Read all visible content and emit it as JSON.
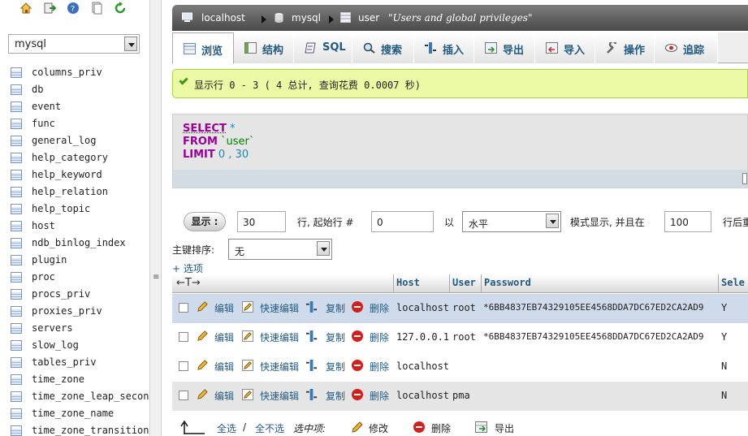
{
  "sidebar": {
    "db_select": "mysql",
    "tables": [
      "columns_priv",
      "db",
      "event",
      "func",
      "general_log",
      "help_category",
      "help_keyword",
      "help_relation",
      "help_topic",
      "host",
      "ndb_binlog_index",
      "plugin",
      "proc",
      "procs_priv",
      "proxies_priv",
      "servers",
      "slow_log",
      "tables_priv",
      "time_zone",
      "time_zone_leap_second",
      "time_zone_name",
      "time_zone_transition"
    ]
  },
  "breadcrumb": {
    "server": "localhost",
    "database": "mysql",
    "table": "user",
    "comment": "\"Users and global privileges\""
  },
  "tabs": [
    {
      "label": "浏览",
      "icon": "browse-icon",
      "active": true
    },
    {
      "label": "结构",
      "icon": "structure-icon"
    },
    {
      "label": "SQL",
      "icon": "sql-icon"
    },
    {
      "label": "搜索",
      "icon": "search-icon"
    },
    {
      "label": "插入",
      "icon": "insert-icon"
    },
    {
      "label": "导出",
      "icon": "export-icon"
    },
    {
      "label": "导入",
      "icon": "import-icon"
    },
    {
      "label": "操作",
      "icon": "wrench-icon"
    },
    {
      "label": "追踪",
      "icon": "eye-icon"
    }
  ],
  "message": "显示行 0 - 3 ( 4 总计, 查询花费 0.0007 秒)",
  "sql": {
    "select_kw": "SELECT",
    "select_rest": " *",
    "from_kw": "FROM",
    "from_rest": " `user`",
    "limit_kw": "LIMIT",
    "limit_rest": " 0 , 30"
  },
  "nav": {
    "show_button": "显示 :",
    "rows_value": "30",
    "start_label": "行, 起始行 #",
    "start_value": "0",
    "mode_label": "以",
    "mode_value": "水平",
    "mode_suffix": "模式显示, 并且在",
    "repeat_value": "100",
    "repeat_suffix": "行后重",
    "sort_label": "主键排序:",
    "sort_value": "无",
    "options_link": "+ 选项"
  },
  "table": {
    "arrows": "←T→",
    "columns": [
      "Host",
      "User",
      "Password",
      "Sele"
    ],
    "actions": {
      "edit": "编辑",
      "quick_edit": "快速编辑",
      "copy": "复制",
      "delete": "删除"
    },
    "rows": [
      {
        "host": "localhost",
        "user": "root",
        "password": "*6BB4837EB74329105EE4568DDA7DC67ED2CA2AD9",
        "select": "Y"
      },
      {
        "host": "127.0.0.1",
        "user": "root",
        "password": "*6BB4837EB74329105EE4568DDA7DC67ED2CA2AD9",
        "select": "Y"
      },
      {
        "host": "localhost",
        "user": "",
        "password": "",
        "select": "N"
      },
      {
        "host": "localhost",
        "user": "pma",
        "password": "",
        "select": "N"
      }
    ]
  },
  "bulk": {
    "select_all": "全选",
    "separator": "/",
    "unselect_all": "全不选",
    "with_selected": "选中项:",
    "edit": "修改",
    "delete": "删除",
    "export": "导出"
  }
}
